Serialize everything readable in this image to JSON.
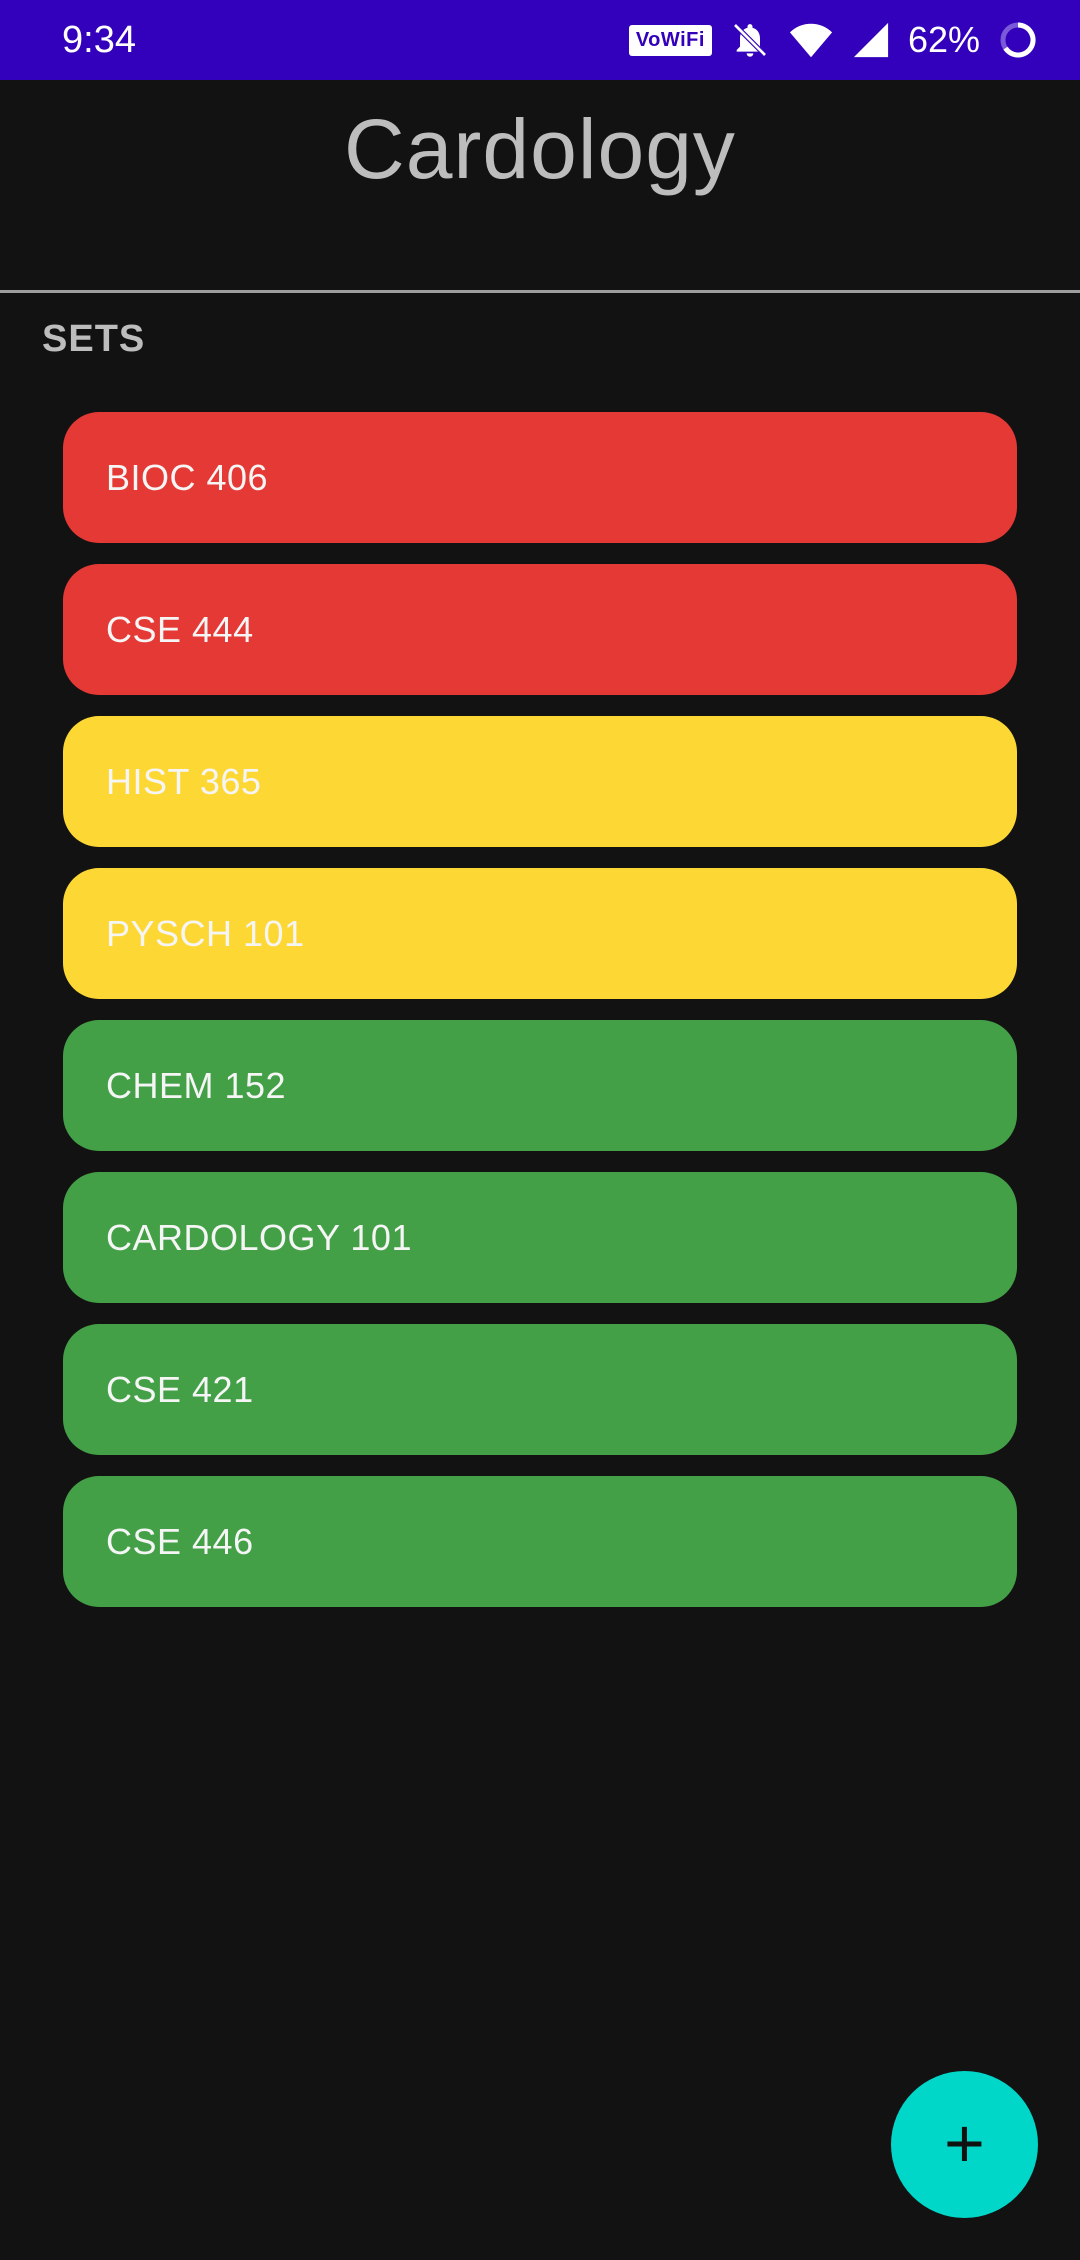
{
  "status_bar": {
    "time": "9:34",
    "vowifi_label": "VoWiFi",
    "battery_percent": "62%",
    "icons": [
      "vowifi-icon",
      "bell-off-icon",
      "wifi-icon",
      "cell-signal-icon",
      "battery-ring-icon"
    ]
  },
  "header": {
    "title": "Cardology"
  },
  "sets_section": {
    "label": "SETS",
    "items": [
      {
        "label": "BIOC 406",
        "color": "#e53935"
      },
      {
        "label": "CSE 444",
        "color": "#e53935"
      },
      {
        "label": "HIST 365",
        "color": "#fdd835"
      },
      {
        "label": "PYSCH 101",
        "color": "#fdd835"
      },
      {
        "label": "CHEM 152",
        "color": "#43a047"
      },
      {
        "label": "CARDOLOGY 101",
        "color": "#43a047"
      },
      {
        "label": "CSE 421",
        "color": "#43a047"
      },
      {
        "label": "CSE 446",
        "color": "#43a047"
      }
    ]
  },
  "fab": {
    "icon": "plus-icon",
    "label": "+",
    "color": "#00d7c8"
  }
}
